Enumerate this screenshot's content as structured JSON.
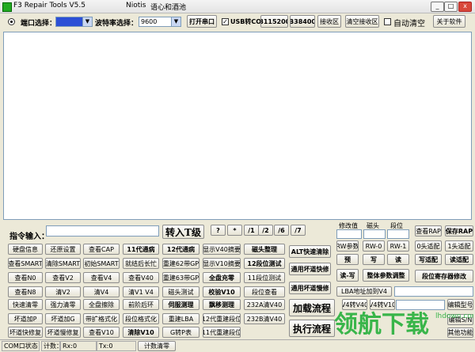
{
  "window": {
    "title": "F3 Repair Tools V5.5",
    "author": "Niotis",
    "slogan": "语心和酒池",
    "controls": {
      "minimize": "_",
      "maximize": "□",
      "close": "x"
    }
  },
  "toolbar": {
    "port_label": "端口选择：",
    "baud_label": "波特率选择：",
    "baud_value": "9600",
    "open_port": "打开串口",
    "usb_com_label": "USB转COM",
    "b115200": "B115200",
    "b38400": "B38400",
    "receive_area": "接收区",
    "clear_receive": "清空接收区",
    "auto_clear": "自动清空",
    "about": "关于软件"
  },
  "command": {
    "label": "指令输入：",
    "send_button": "转入T级",
    "symbols": [
      "?",
      "*",
      "/1",
      "/2",
      "/6",
      "/7"
    ]
  },
  "headers": {
    "modify_value": "修改值",
    "head": "磁头",
    "segment": "段位"
  },
  "grid": [
    [
      "硬盘信息",
      "还原设置",
      "查看CAP",
      "11代通病",
      "12代通病",
      "显示V40摘要",
      "磁头整理"
    ],
    [
      "查看SMART",
      "清除SMART",
      "初始SMART",
      "就结后长忙",
      "重建62带GP",
      "显示V10摘要",
      "12段位测试"
    ],
    [
      "查看N0",
      "查看V2",
      "查看V4",
      "查看V40",
      "重建63带GP",
      "全盘充零",
      "11段位测试"
    ],
    [
      "查看N8",
      "清V2",
      "清V4",
      "清V1 V4",
      "磁头测试",
      "校验V10",
      "段位查看"
    ],
    [
      "快速清零",
      "强力清零",
      "全盘擦除",
      "前阶后环",
      "伺服测理",
      "飘移测理",
      "232A清V40"
    ],
    [
      "坏道加P",
      "坏道加G",
      "带扩格式化",
      "段位格式化",
      "重建LBA",
      "12代重建段位",
      "232B清V40"
    ],
    [
      "坏道快修复",
      "坏道慢修复",
      "查看V10",
      "清除V10",
      "G转P表",
      "11代重建段位",
      ""
    ]
  ],
  "alt_buttons": {
    "alt_clear": "ALT快速清除",
    "bad_fast": "通用坏道快修",
    "bad_slow": "通用坏道慢修",
    "load_flow": "加载流程",
    "exec_flow": "执行流程"
  },
  "right_panel": {
    "rw_param": "RW参数",
    "rw0": "RW-0",
    "rw1": "RW-1",
    "pre": "预",
    "write": "写",
    "read": "读",
    "read_write": "读-写",
    "whole_param": "整体参数调整",
    "view_rap": "查看RAP",
    "save_rap": "保存RAP",
    "head0": "0头适配",
    "head1": "1头适配",
    "write_adapt": "写适配",
    "read_adapt": "读适配",
    "seg_reg_modify": "段位寄存器修改",
    "lba_label": "LBA地址加到V4",
    "v4_to_v40": "V4转V40",
    "v4_to_v10": "V4转V10",
    "edit_model": "编辑型号",
    "edit_sn": "编辑S/N",
    "other": "其他功能"
  },
  "statusbar": {
    "com_status": "COM口状态：",
    "count": "计数：",
    "rx": "Rx:0",
    "tx": "Tx:0",
    "clear_count": "计数清零"
  },
  "watermark": {
    "text": "领航下载",
    "url": "lhdown.com"
  }
}
